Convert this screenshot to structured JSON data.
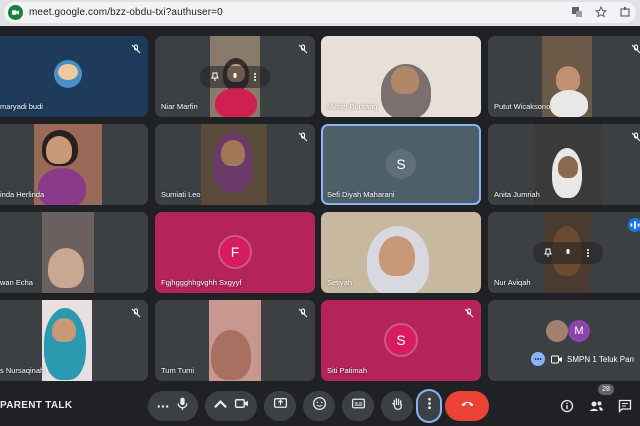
{
  "browser": {
    "url": "meet.google.com/bzz-obdu-txi?authuser=0"
  },
  "participants": [
    {
      "name": "maryadi budi",
      "muted": true
    },
    {
      "name": "Niar Marfin",
      "muted": true
    },
    {
      "name": "Miftah Bontang",
      "muted": false
    },
    {
      "name": "Putut Wicaksono",
      "muted": true
    },
    {
      "name": "inda Herlinda",
      "muted": false
    },
    {
      "name": "Sumiati Leo",
      "muted": true
    },
    {
      "name": "Sefi Diyah Maharani",
      "initial": "S",
      "avatar_color": "#5f6f79",
      "muted": false
    },
    {
      "name": "Anita Jumriah",
      "muted": true
    },
    {
      "name": "wan Echa",
      "muted": false
    },
    {
      "name": "Fgjhggghhgvghh Sxgyyf",
      "initial": "F",
      "avatar_color": "#d81b60",
      "muted": false
    },
    {
      "name": "Setiyah",
      "muted": false
    },
    {
      "name": "Nur Aviqah",
      "muted": false
    },
    {
      "name": "s Nursaqinah",
      "muted": true
    },
    {
      "name": "Tum Tumi",
      "muted": true
    },
    {
      "name": "Siti Patimah",
      "initial": "S",
      "avatar_color": "#d81b60",
      "muted": true
    },
    {
      "name": "",
      "muted": false
    }
  ],
  "others_tile": {
    "initial": "M",
    "avatar_color": "#8e44ad",
    "label": "SMPN 1 Teluk Pan"
  },
  "toolbar": {
    "meeting_name": "PARENT TALK",
    "participant_count": "28"
  },
  "colors": {
    "background": "#202124",
    "tile": "#3c4043",
    "accent": "#8ab4f8",
    "end_call": "#ea4335"
  }
}
